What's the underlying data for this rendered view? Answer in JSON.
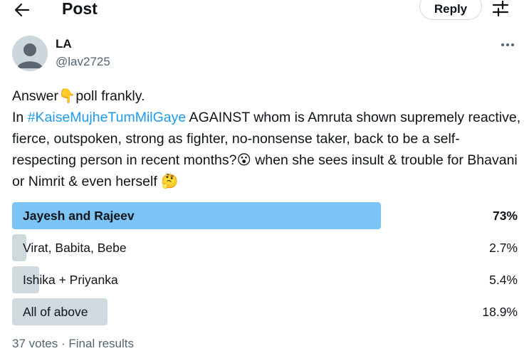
{
  "header": {
    "title": "Post",
    "reply_label": "Reply"
  },
  "author": {
    "name": "LA",
    "handle": "@lav2725"
  },
  "tweet": {
    "line1_text": "Answer",
    "line1_emoji": "👇",
    "line1_rest": "poll frankly.",
    "line2_prefix": "In ",
    "hashtag": "#KaiseMujheTumMilGaye",
    "body": " AGAINST whom is Amruta shown supremely reactive, fierce, outspoken, strong as fighter, no-nonsense taker, back to be a self-respecting person in recent months?",
    "emoji_surprised": "😮",
    "body2": " when she sees insult & trouble for Bhavani or Nimrit & even herself ",
    "emoji_thinking": "🤔"
  },
  "poll": {
    "options": [
      {
        "label": "Jayesh and Rajeev",
        "percent": "73%",
        "value": 73,
        "winner": true
      },
      {
        "label": "Virat, Babita, Bebe",
        "percent": "2.7%",
        "value": 2.7,
        "winner": false
      },
      {
        "label": "Ishika + Priyanka",
        "percent": "5.4%",
        "value": 5.4,
        "winner": false
      },
      {
        "label": "All of above",
        "percent": "18.9%",
        "value": 18.9,
        "winner": false
      }
    ],
    "footer": "37 votes · Final results"
  },
  "colors": {
    "winner_bar": "#7cc4f5",
    "bar": "#cfd9de",
    "link": "#1d9bf0",
    "muted": "#536471"
  }
}
